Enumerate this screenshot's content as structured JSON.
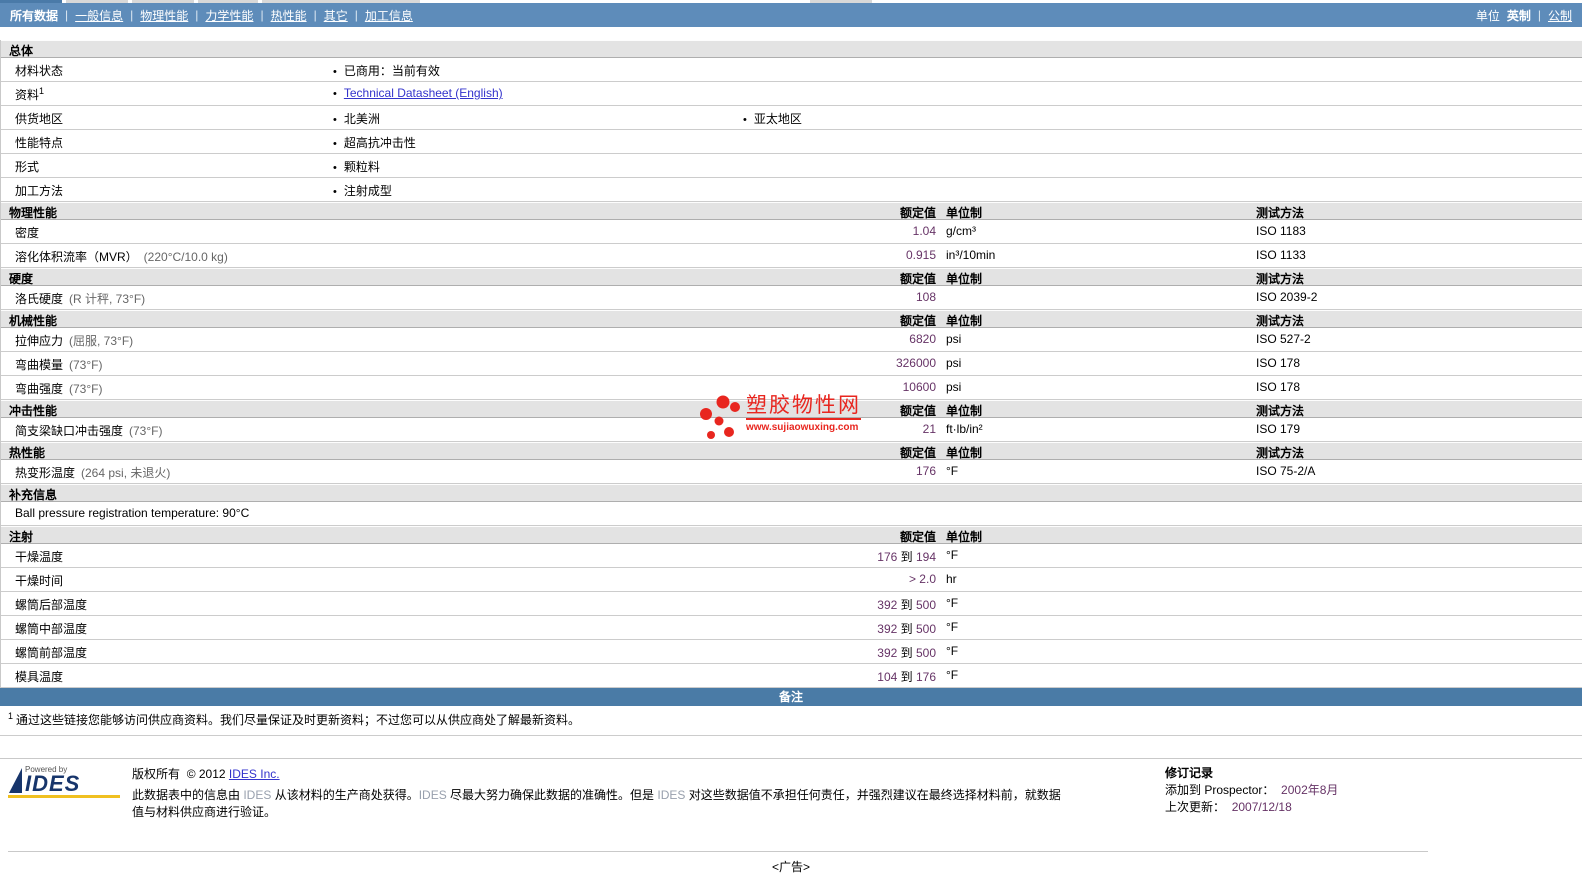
{
  "nav": {
    "items": [
      {
        "id": "tab-all-data",
        "label": "所有数据",
        "active": true
      },
      {
        "id": "tab-general-info",
        "label": "一般信息",
        "active": false
      },
      {
        "id": "tab-physical",
        "label": "物理性能",
        "active": false
      },
      {
        "id": "tab-mechanical",
        "label": "力学性能",
        "active": false
      },
      {
        "id": "tab-thermal",
        "label": "热性能",
        "active": false
      },
      {
        "id": "tab-other",
        "label": "其它",
        "active": false
      },
      {
        "id": "tab-processing",
        "label": "加工信息",
        "active": false
      }
    ],
    "units_label": "单位",
    "unit_active": "英制",
    "unit_link": "公制"
  },
  "colors": {
    "nav_blue": "#5e8cba",
    "notes_blue": "#4a7ba6",
    "value_purple": "#663366",
    "watermark_red": "#e8261f",
    "link_blue": "#3333cc"
  },
  "table": {
    "col_labels": {
      "value": "额定值",
      "unit": "单位制",
      "test": "测试方法"
    },
    "sections": [
      {
        "label": "总体",
        "cols": false,
        "test": false,
        "rows": [
          {
            "type": "bullets",
            "name": "材料状态",
            "items": [
              {
                "text": "已商用：当前有效"
              }
            ]
          },
          {
            "type": "bullets",
            "name": "资料",
            "name_sup": "1",
            "items": [
              {
                "text": "Technical Datasheet (English)",
                "link": true
              }
            ]
          },
          {
            "type": "bullets",
            "name": "供货地区",
            "items": [
              {
                "text": "北美洲"
              },
              {
                "text": "亚太地区"
              }
            ]
          },
          {
            "type": "bullets",
            "name": "性能特点",
            "items": [
              {
                "text": "超高抗冲击性"
              }
            ]
          },
          {
            "type": "bullets",
            "name": "形式",
            "items": [
              {
                "text": "颗粒料"
              }
            ]
          },
          {
            "type": "bullets",
            "name": "加工方法",
            "items": [
              {
                "text": "注射成型"
              }
            ]
          }
        ]
      },
      {
        "label": "物理性能",
        "cols": true,
        "test": true,
        "rows": [
          {
            "type": "value",
            "name": "密度",
            "v1": "1.04",
            "unit": "g/cm³",
            "test": "ISO 1183"
          },
          {
            "type": "value",
            "name": "溶化体积流率（MVR）",
            "cond": "(220°C/10.0 kg)",
            "v1": "0.915",
            "unit": "in³/10min",
            "test": "ISO 1133"
          }
        ]
      },
      {
        "label": "硬度",
        "cols": true,
        "test": true,
        "rows": [
          {
            "type": "value",
            "name": "洛氏硬度",
            "cond": "(R 计秤, 73°F)",
            "v1": "108",
            "unit": "",
            "test": "ISO 2039-2"
          }
        ]
      },
      {
        "label": "机械性能",
        "cols": true,
        "test": true,
        "rows": [
          {
            "type": "value",
            "name": "拉伸应力",
            "cond": "(屈服, 73°F)",
            "v1": "6820",
            "unit": "psi",
            "test": "ISO 527-2"
          },
          {
            "type": "value",
            "name": "弯曲模量",
            "cond": "(73°F)",
            "v1": "326000",
            "unit": "psi",
            "test": "ISO 178"
          },
          {
            "type": "value",
            "name": "弯曲强度",
            "cond": "(73°F)",
            "v1": "10600",
            "unit": "psi",
            "test": "ISO 178"
          }
        ]
      },
      {
        "label": "冲击性能",
        "cols": true,
        "test": true,
        "rows": [
          {
            "type": "value",
            "name": "简支梁缺口冲击强度",
            "cond": "(73°F)",
            "v1": "21",
            "unit": "ft·lb/in²",
            "test": "ISO 179"
          }
        ]
      },
      {
        "label": "热性能",
        "cols": true,
        "test": true,
        "rows": [
          {
            "type": "value",
            "name": "热变形温度",
            "cond": "(264 psi, 未退火)",
            "v1": "176",
            "unit": "°F",
            "test": "ISO 75-2/A"
          }
        ]
      },
      {
        "label": "补充信息",
        "cols": false,
        "test": false,
        "rows": [
          {
            "type": "text",
            "text": "Ball pressure registration temperature: 90°C"
          }
        ]
      },
      {
        "label": "注射",
        "cols": true,
        "test": false,
        "rows": [
          {
            "type": "value",
            "name": "干燥温度",
            "v1": "176",
            "joiner": "到",
            "v2": "194",
            "unit": "°F"
          },
          {
            "type": "value",
            "name": "干燥时间",
            "v1": "> 2.0",
            "unit": "hr"
          },
          {
            "type": "value",
            "name": "螺筒后部温度",
            "v1": "392",
            "joiner": "到",
            "v2": "500",
            "unit": "°F"
          },
          {
            "type": "value",
            "name": "螺筒中部温度",
            "v1": "392",
            "joiner": "到",
            "v2": "500",
            "unit": "°F"
          },
          {
            "type": "value",
            "name": "螺筒前部温度",
            "v1": "392",
            "joiner": "到",
            "v2": "500",
            "unit": "°F"
          },
          {
            "type": "value",
            "name": "模具温度",
            "v1": "104",
            "joiner": "到",
            "v2": "176",
            "unit": "°F"
          }
        ]
      }
    ]
  },
  "notes_bar_label": "备注",
  "footnote": {
    "sup": "1",
    "text": "通过这些链接您能够访问供应商资料。我们尽量保证及时更新资料；不过您可以从供应商处了解最新资料。"
  },
  "watermark": {
    "title": "塑胶物性网",
    "url": "www.sujiaowuxing.com"
  },
  "footer": {
    "logo_powered": "Powered by",
    "logo_name": "IDES",
    "copyright_label": "版权所有",
    "copyright_year": "© 2012",
    "copyright_link": "IDES Inc.",
    "disclaimer_segments": [
      {
        "text": "此数据表中的信息由 "
      },
      {
        "text": "IDES",
        "ides": true
      },
      {
        "text": " 从该材料的生产商处获得。"
      },
      {
        "text": "IDES",
        "ides": true
      },
      {
        "text": " 尽最大努力确保此数据的准确性。但是 "
      },
      {
        "text": "IDES",
        "ides": true
      },
      {
        "text": " 对这些数据值不承担任何责任，并强烈建议在最终选择材料前，就数据值与材料供应商进行验证。"
      }
    ],
    "revision_title": "修订记录",
    "added_label": "添加到 Prospector：",
    "added_value": "2002年8月",
    "updated_label": "上次更新：",
    "updated_value": "2007/12/18"
  },
  "ad_label": "<广告>"
}
